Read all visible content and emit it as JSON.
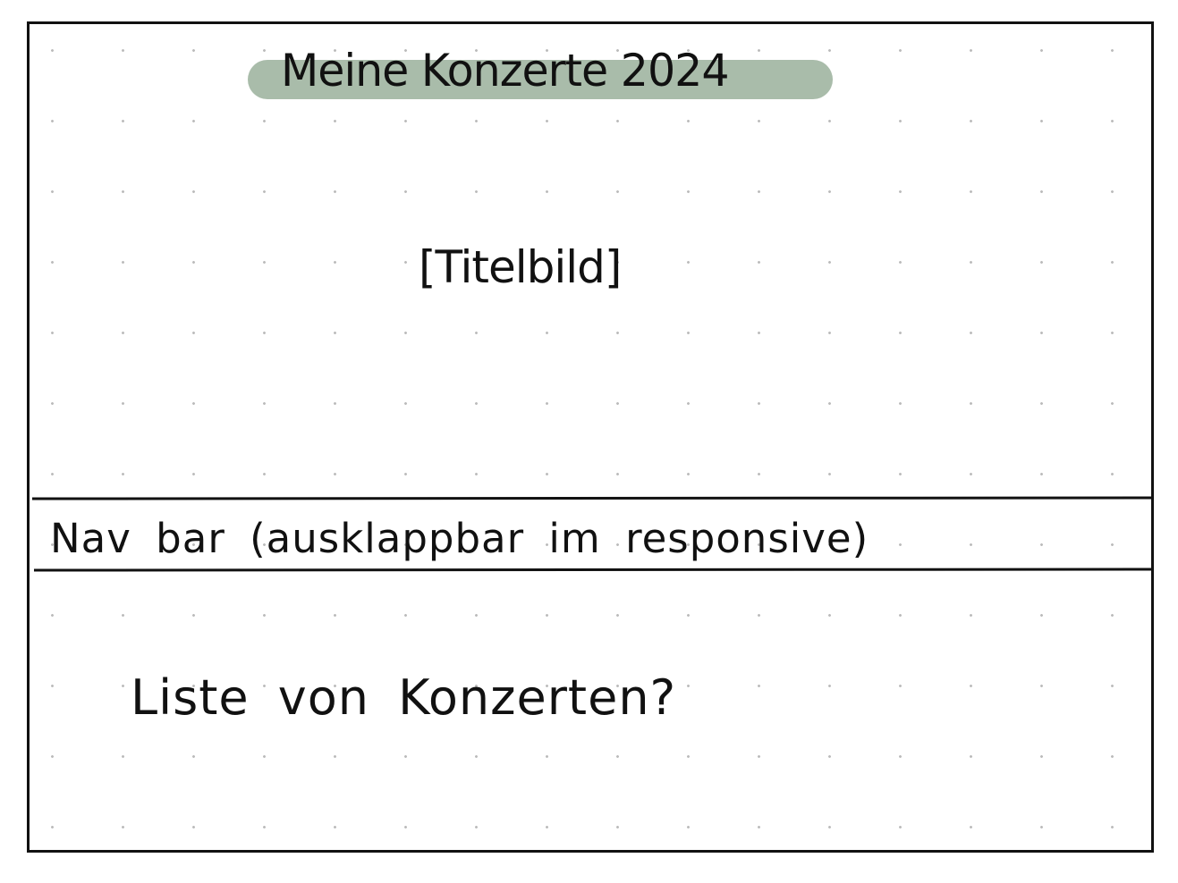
{
  "colors": {
    "title_highlight": "#a9bcaa",
    "grid_dot": "#bcbcbc",
    "ink": "#111111"
  },
  "header": {
    "title": "Meine Konzerte 2024"
  },
  "hero": {
    "placeholder": "[Titelbild]"
  },
  "nav": {
    "label": "Nav bar (ausklappbar im responsive)"
  },
  "main": {
    "list_label": "Liste von Konzerten?"
  }
}
